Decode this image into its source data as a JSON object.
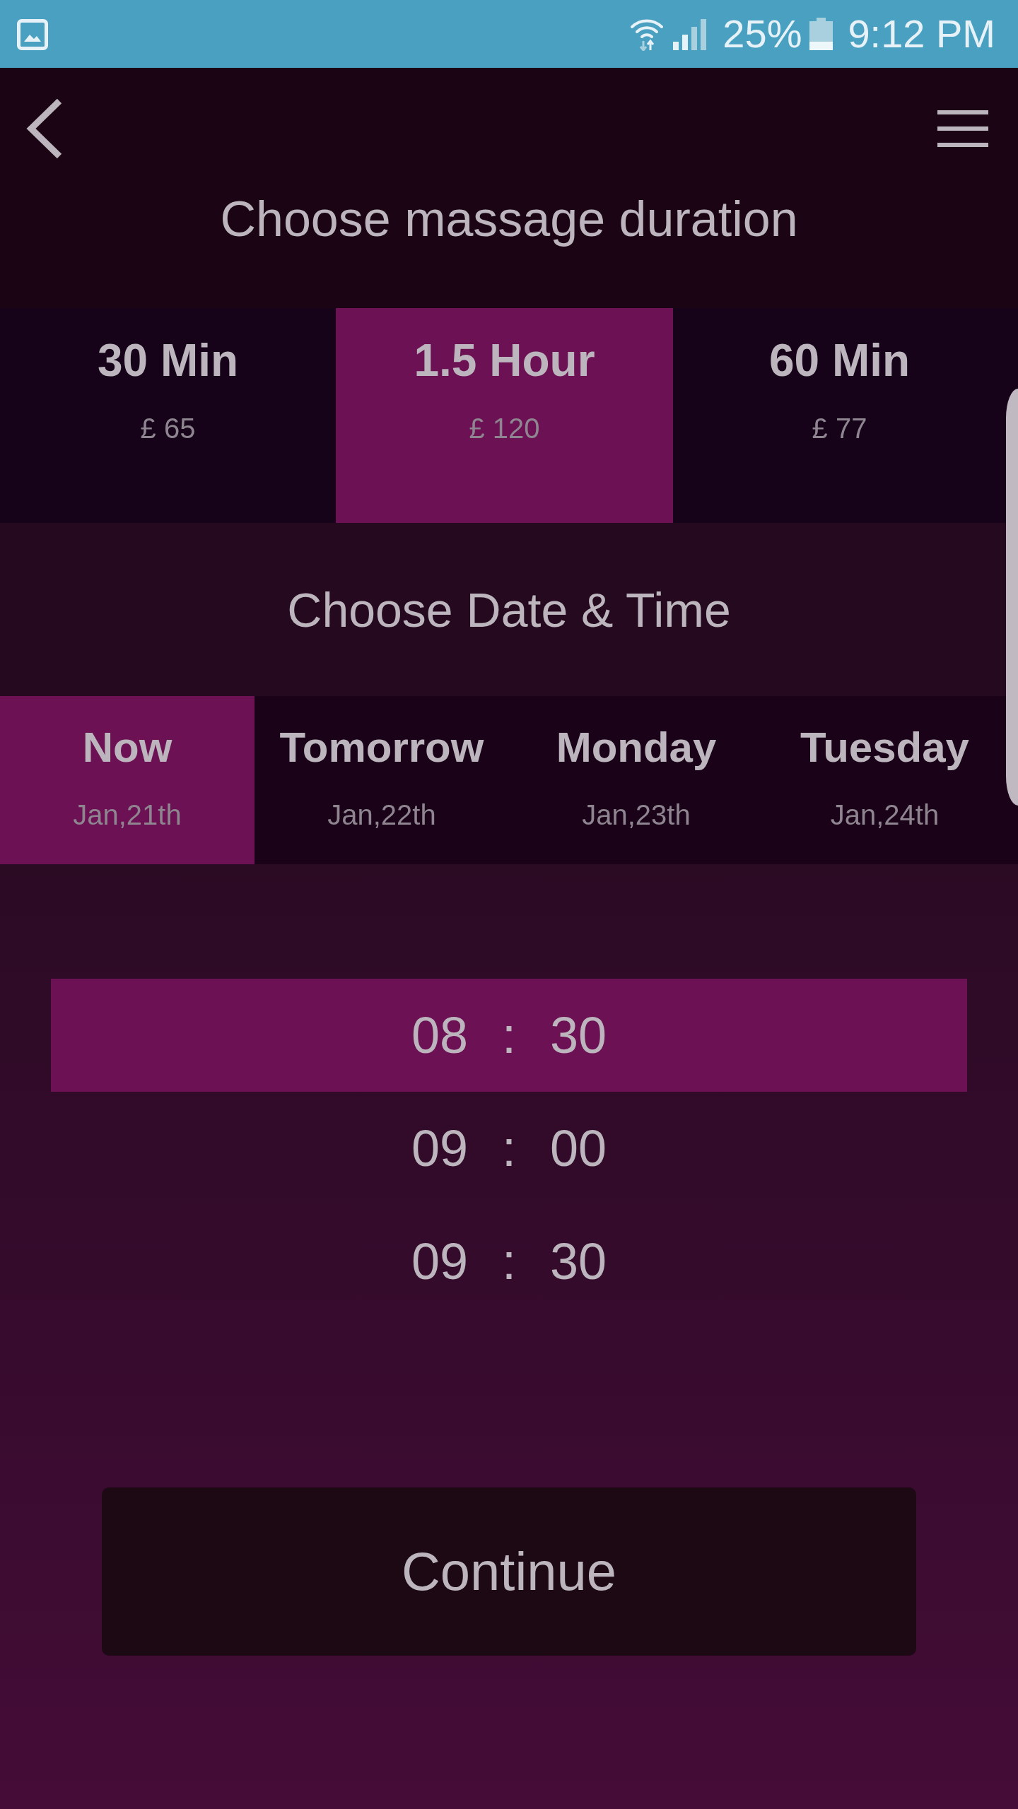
{
  "status_bar": {
    "battery": "25%",
    "time": "9:12 PM"
  },
  "header": {
    "title": "Choose massage duration"
  },
  "durations": [
    {
      "label": "30 Min",
      "price": "£ 65",
      "selected": false
    },
    {
      "label": "1.5 Hour",
      "price": "£ 120",
      "selected": true
    },
    {
      "label": "60 Min",
      "price": "£ 77",
      "selected": false
    }
  ],
  "date_section": {
    "title": "Choose Date & Time"
  },
  "days": [
    {
      "label": "Now",
      "date": "Jan,21th",
      "selected": true
    },
    {
      "label": "Tomorrow",
      "date": "Jan,22th",
      "selected": false
    },
    {
      "label": "Monday",
      "date": "Jan,23th",
      "selected": false
    },
    {
      "label": "Tuesday",
      "date": "Jan,24th",
      "selected": false
    }
  ],
  "times": [
    {
      "time": "08 : 30",
      "selected": true
    },
    {
      "time": "09 : 00",
      "selected": false
    },
    {
      "time": "09 : 30",
      "selected": false
    }
  ],
  "continue_button": {
    "label": "Continue"
  }
}
